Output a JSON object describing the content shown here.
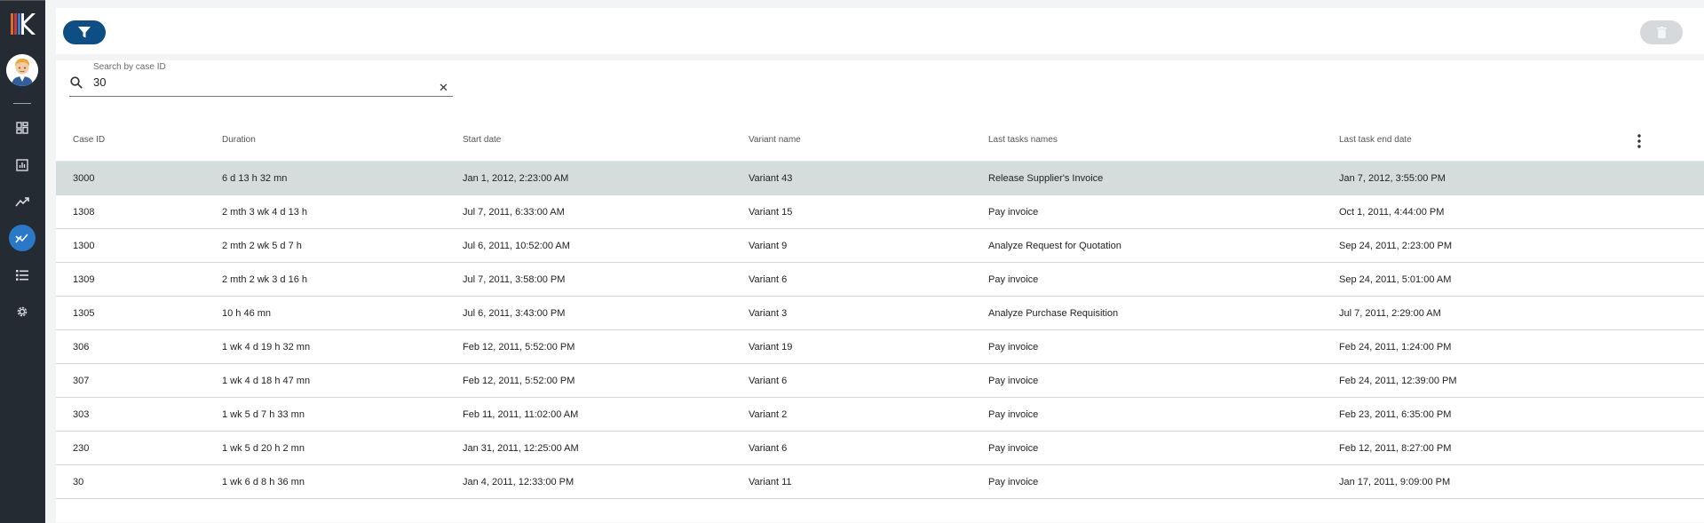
{
  "search": {
    "label": "Search by case ID",
    "value": "30",
    "clear": "✕"
  },
  "table": {
    "columns": [
      "Case ID",
      "Duration",
      "Start date",
      "Variant name",
      "Last tasks names",
      "Last task end date"
    ],
    "rows": [
      [
        "3000",
        "6 d 13 h 32 mn",
        "Jan 1, 2012, 2:23:00 AM",
        "Variant 43",
        "Release Supplier's Invoice",
        "Jan 7, 2012, 3:55:00 PM"
      ],
      [
        "1308",
        "2 mth 3 wk 4 d 13 h",
        "Jul 7, 2011, 6:33:00 AM",
        "Variant 15",
        "Pay invoice",
        "Oct 1, 2011, 4:44:00 PM"
      ],
      [
        "1300",
        "2 mth 2 wk 5 d 7 h",
        "Jul 6, 2011, 10:52:00 AM",
        "Variant 9",
        "Analyze Request for Quotation",
        "Sep 24, 2011, 2:23:00 PM"
      ],
      [
        "1309",
        "2 mth 2 wk 3 d 16 h",
        "Jul 7, 2011, 3:58:00 PM",
        "Variant 6",
        "Pay invoice",
        "Sep 24, 2011, 5:01:00 AM"
      ],
      [
        "1305",
        "10 h 46 mn",
        "Jul 6, 2011, 3:43:00 PM",
        "Variant 3",
        "Analyze Purchase Requisition",
        "Jul 7, 2011, 2:29:00 AM"
      ],
      [
        "306",
        "1 wk 4 d 19 h 32 mn",
        "Feb 12, 2011, 5:52:00 PM",
        "Variant 19",
        "Pay invoice",
        "Feb 24, 2011, 1:24:00 PM"
      ],
      [
        "307",
        "1 wk 4 d 18 h 47 mn",
        "Feb 12, 2011, 5:52:00 PM",
        "Variant 6",
        "Pay invoice",
        "Feb 24, 2011, 12:39:00 PM"
      ],
      [
        "303",
        "1 wk 5 d 7 h 33 mn",
        "Feb 11, 2011, 11:02:00 AM",
        "Variant 2",
        "Pay invoice",
        "Feb 23, 2011, 6:35:00 PM"
      ],
      [
        "230",
        "1 wk 5 d 20 h 2 mn",
        "Jan 31, 2011, 12:25:00 AM",
        "Variant 6",
        "Pay invoice",
        "Feb 12, 2011, 8:27:00 PM"
      ],
      [
        "30",
        "1 wk 6 d 8 h 36 mn",
        "Jan 4, 2011, 12:33:00 PM",
        "Variant 11",
        "Pay invoice",
        "Jan 17, 2011, 9:09:00 PM"
      ]
    ]
  },
  "icons": {
    "nav": [
      "dashboard-icon",
      "report-icon",
      "trend-icon",
      "process-map-icon",
      "list-icon",
      "settings-icon"
    ],
    "active_nav": "process-map-icon"
  },
  "colors": {
    "sidebar": "#242b33",
    "accent": "#2a78c8",
    "filter_button": "#0d4f85",
    "selected_row": "#d4dcdc"
  }
}
